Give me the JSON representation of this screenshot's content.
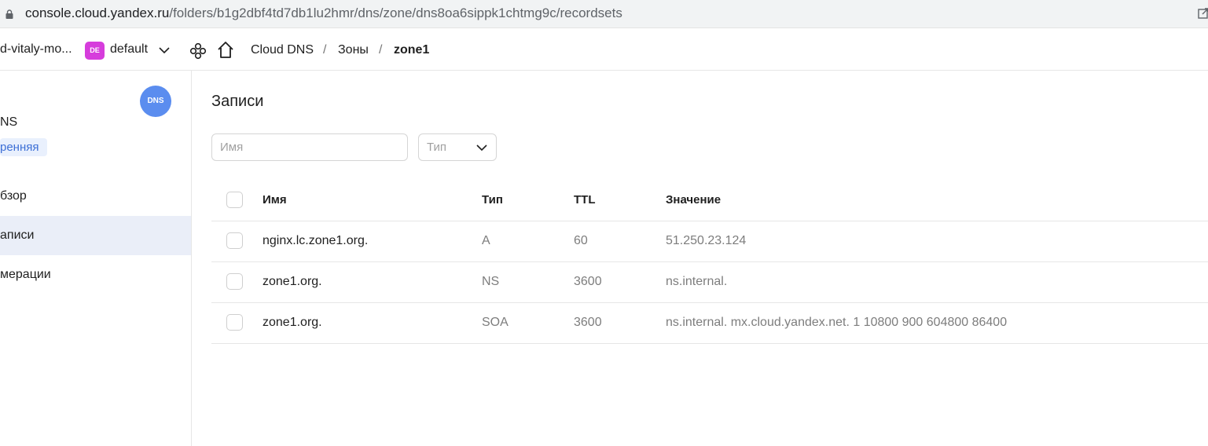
{
  "browser": {
    "url_host": "console.cloud.yandex.ru",
    "url_path": "/folders/b1g2dbf4td7db1lu2hmr/dns/zone/dns8oa6sippk1chtmg9c/recordsets"
  },
  "header": {
    "cloud_name": "d-vitaly-mo...",
    "folder_badge": "DE",
    "folder_name": "default",
    "breadcrumbs": [
      "Cloud DNS",
      "Зоны",
      "zone1"
    ],
    "separator": "/"
  },
  "sidebar": {
    "service_logo": "DNS",
    "service_title": "NS",
    "zone_tag": "ренняя",
    "items": [
      {
        "label": "бзор"
      },
      {
        "label": "аписи"
      },
      {
        "label": "мерации"
      }
    ]
  },
  "main": {
    "title": "Записи",
    "filter_name_placeholder": "Имя",
    "filter_type_placeholder": "Тип",
    "columns": [
      "Имя",
      "Тип",
      "TTL",
      "Значение"
    ],
    "rows": [
      {
        "name": "nginx.lc.zone1.org.",
        "type": "A",
        "ttl": "60",
        "value": "51.250.23.124"
      },
      {
        "name": "zone1.org.",
        "type": "NS",
        "ttl": "3600",
        "value": "ns.internal."
      },
      {
        "name": "zone1.org.",
        "type": "SOA",
        "ttl": "3600",
        "value": "ns.internal. mx.cloud.yandex.net. 1 10800 900 604800 86400"
      }
    ]
  },
  "colors": {
    "accent": "#5b8def",
    "folder_badge": "#d63ddc",
    "active_nav": "#eaeef8"
  }
}
